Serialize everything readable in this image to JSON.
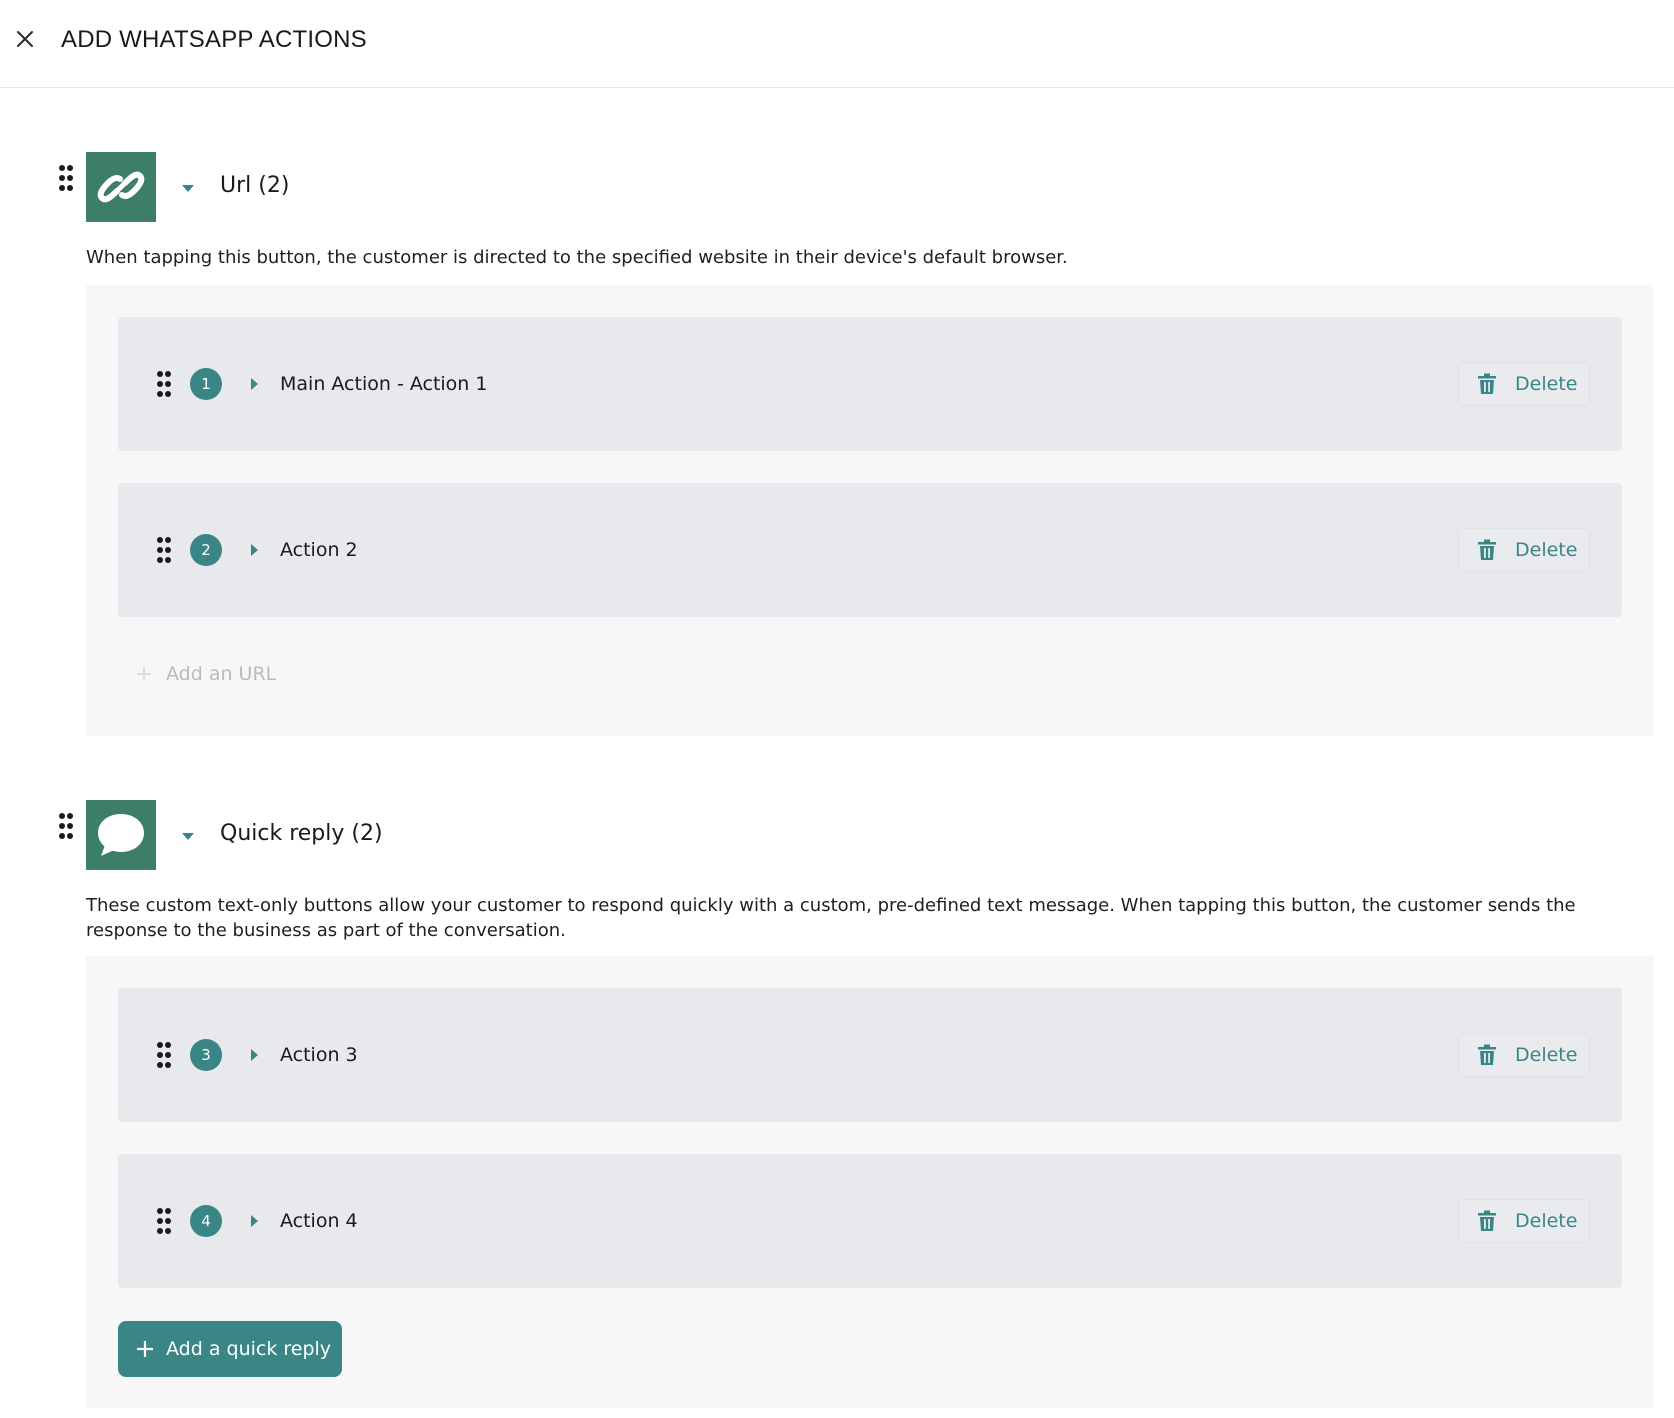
{
  "header": {
    "title": "ADD WHATSAPP ACTIONS"
  },
  "colors": {
    "icon_bg": "#3c7e69",
    "accent": "#3a8686",
    "panel_bg": "#f7f7f7",
    "card_bg": "#e8e9ec"
  },
  "sections": [
    {
      "title": "Url (2)",
      "icon": "link-icon",
      "description": "When tapping this button, the customer is directed to the specified website in their device's default browser.",
      "actions": [
        {
          "number": "1",
          "title": "Main Action - Action 1",
          "delete_label": "Delete"
        },
        {
          "number": "2",
          "title": "Action 2",
          "delete_label": "Delete"
        }
      ],
      "add_label": "Add an URL"
    },
    {
      "title": "Quick reply (2)",
      "icon": "chat-bubble-icon",
      "description": "These custom text-only buttons allow your customer to respond quickly with a custom, pre-defined text message. When tapping this button, the customer sends the response to the business as part of the conversation.",
      "actions": [
        {
          "number": "3",
          "title": "Action 3",
          "delete_label": "Delete"
        },
        {
          "number": "4",
          "title": "Action 4",
          "delete_label": "Delete"
        }
      ],
      "add_label": "Add a quick reply"
    }
  ]
}
